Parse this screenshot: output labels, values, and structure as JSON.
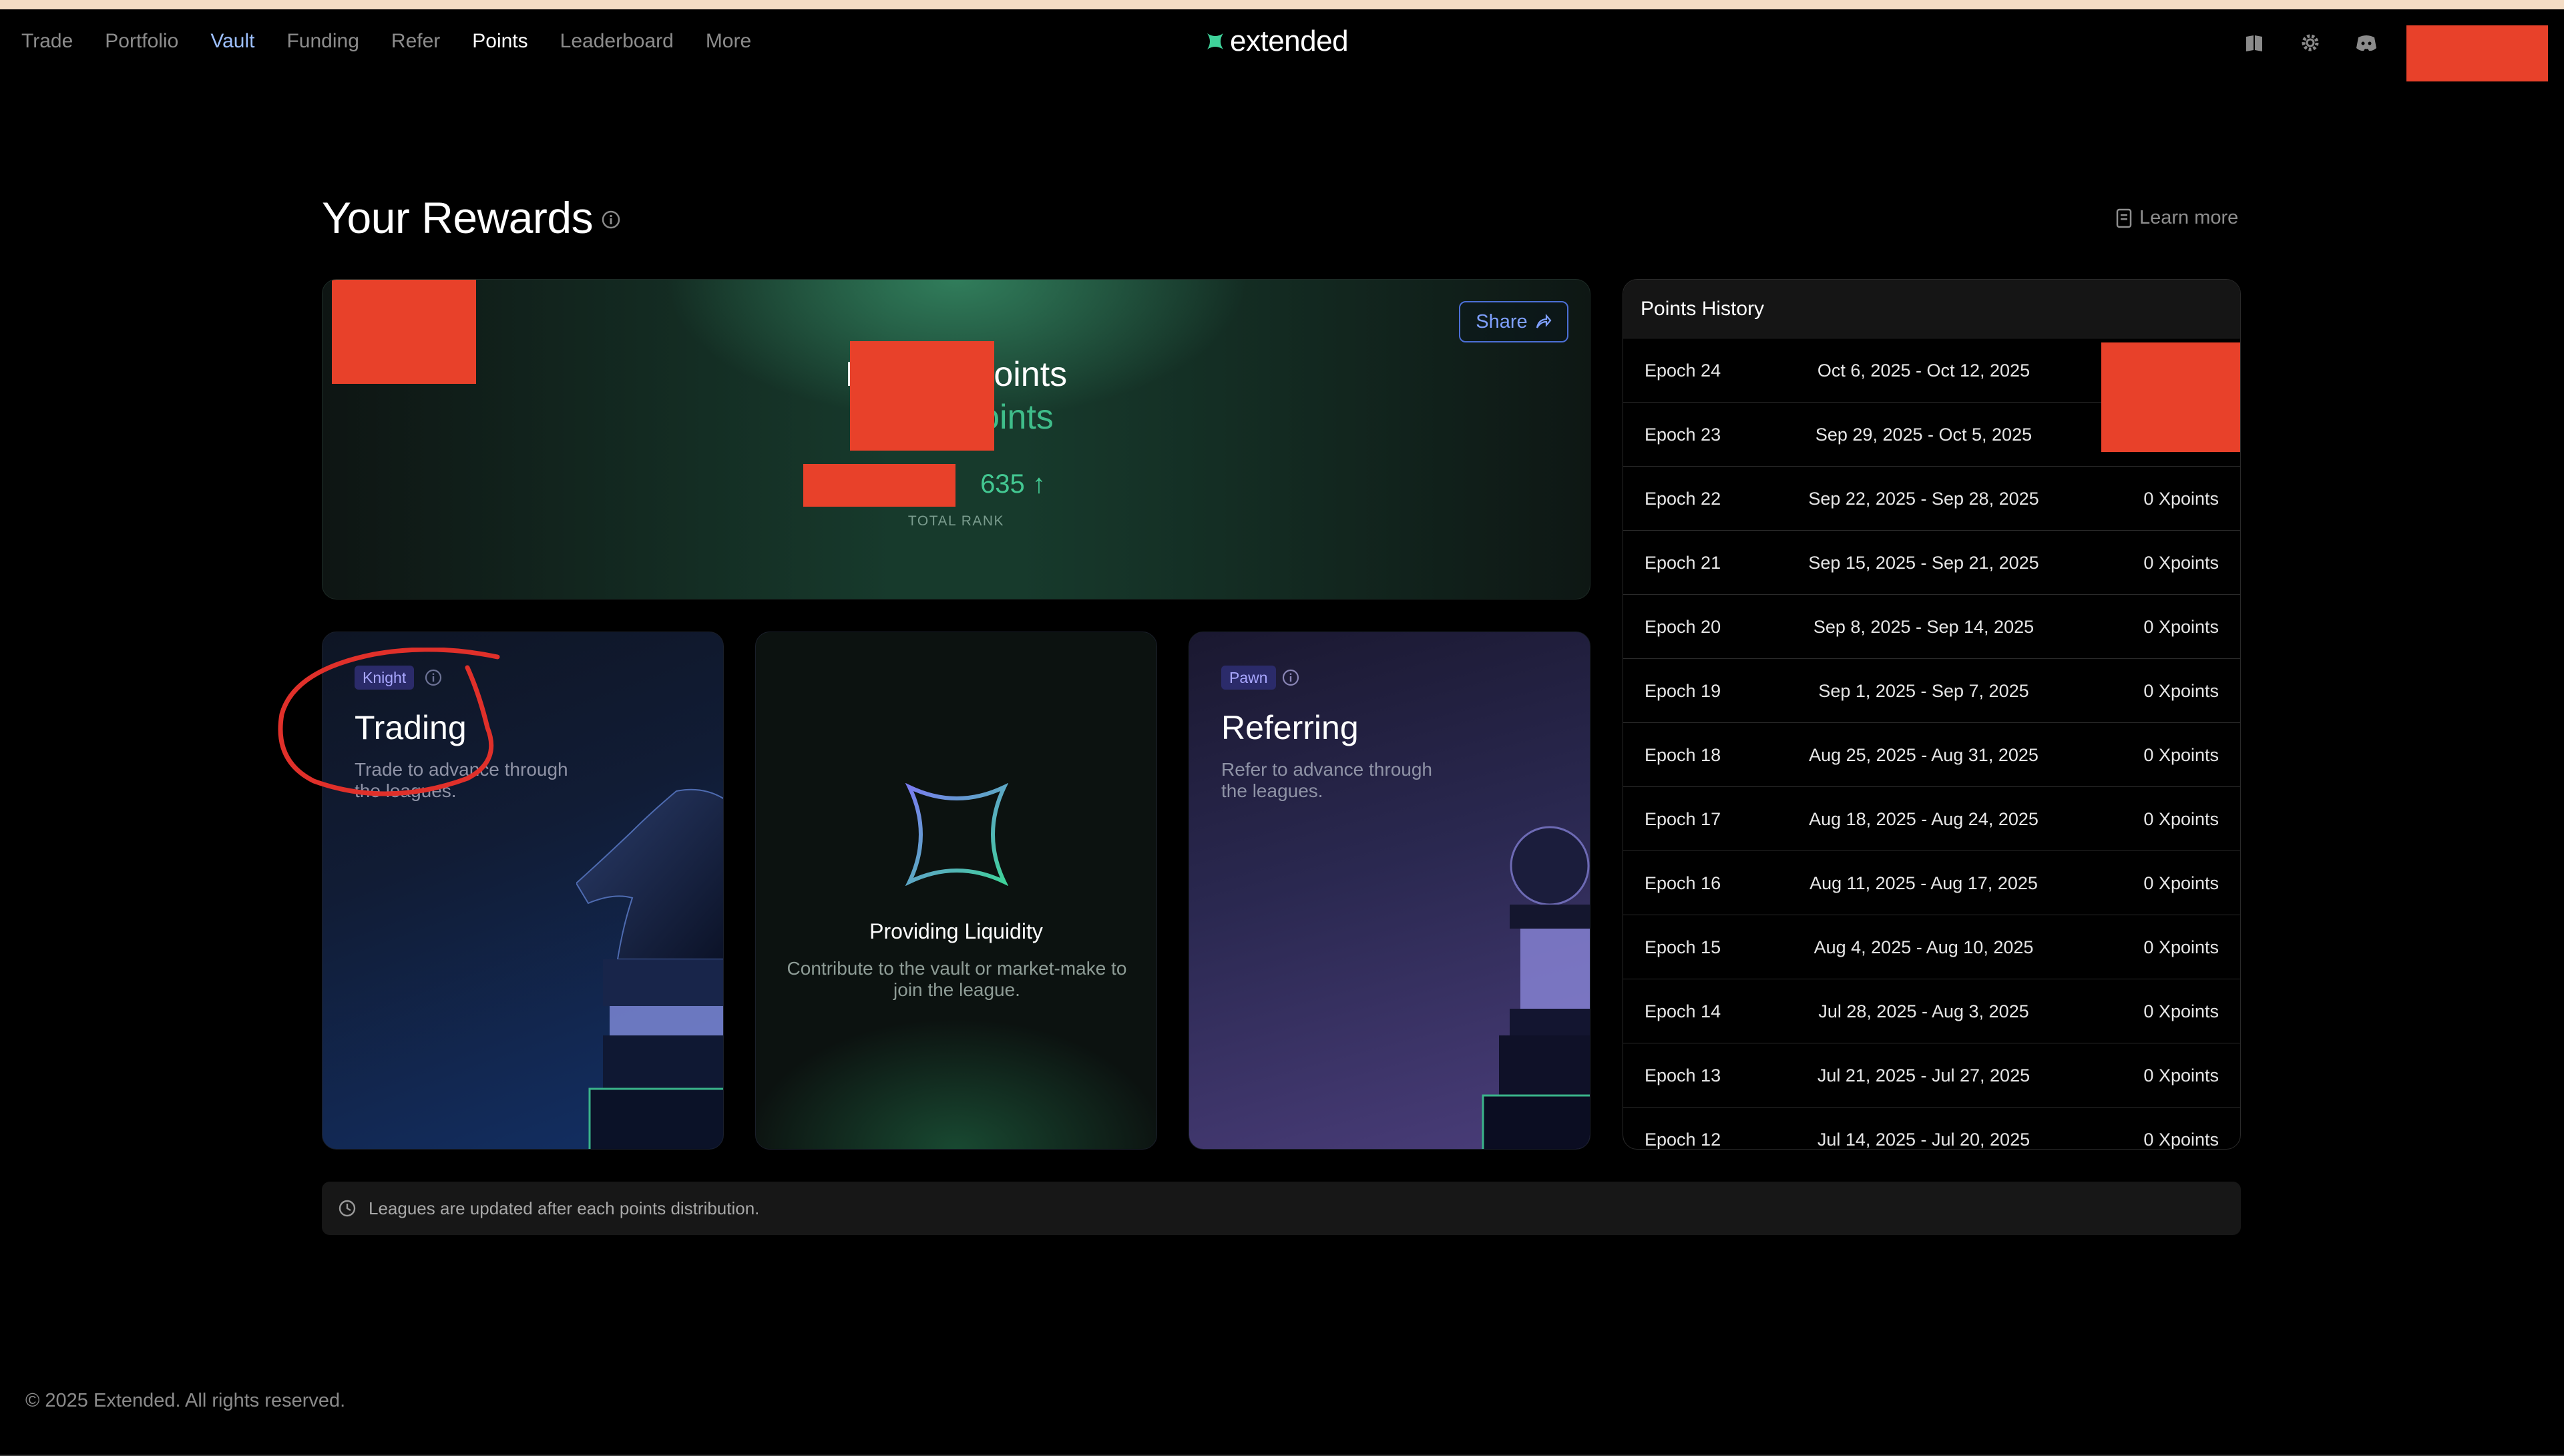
{
  "nav": {
    "links": [
      "Trade",
      "Portfolio",
      "Vault",
      "Funding",
      "Refer",
      "Points",
      "Leaderboard",
      "More"
    ],
    "logo": "extended"
  },
  "page": {
    "title": "Your Rewards",
    "learn_more": "Learn more"
  },
  "hero": {
    "share": "Share",
    "line1": "M          Points",
    "line2": "C          oints",
    "rank": "635",
    "rank_label": "TOTAL RANK"
  },
  "leagues": {
    "trading": {
      "badge": "Knight",
      "title": "Trading",
      "desc": "Trade to advance through the leagues."
    },
    "liquidity": {
      "title": "Providing Liquidity",
      "desc": "Contribute to the vault or market-make to join the league."
    },
    "referring": {
      "badge": "Pawn",
      "title": "Referring",
      "desc": "Refer to advance through the leagues."
    }
  },
  "history": {
    "title": "Points History",
    "rows": [
      {
        "epoch": "Epoch 24",
        "range": "Oct 6, 2025 - Oct 12, 2025",
        "points": ""
      },
      {
        "epoch": "Epoch 23",
        "range": "Sep 29, 2025 - Oct 5, 2025",
        "points": ""
      },
      {
        "epoch": "Epoch 22",
        "range": "Sep 22, 2025 - Sep 28, 2025",
        "points": "0 Xpoints"
      },
      {
        "epoch": "Epoch 21",
        "range": "Sep 15, 2025 - Sep 21, 2025",
        "points": "0 Xpoints"
      },
      {
        "epoch": "Epoch 20",
        "range": "Sep 8, 2025 - Sep 14, 2025",
        "points": "0 Xpoints"
      },
      {
        "epoch": "Epoch 19",
        "range": "Sep 1, 2025 - Sep 7, 2025",
        "points": "0 Xpoints"
      },
      {
        "epoch": "Epoch 18",
        "range": "Aug 25, 2025 - Aug 31, 2025",
        "points": "0 Xpoints"
      },
      {
        "epoch": "Epoch 17",
        "range": "Aug 18, 2025 - Aug 24, 2025",
        "points": "0 Xpoints"
      },
      {
        "epoch": "Epoch 16",
        "range": "Aug 11, 2025 - Aug 17, 2025",
        "points": "0 Xpoints"
      },
      {
        "epoch": "Epoch 15",
        "range": "Aug 4, 2025 - Aug 10, 2025",
        "points": "0 Xpoints"
      },
      {
        "epoch": "Epoch 14",
        "range": "Jul 28, 2025 - Aug 3, 2025",
        "points": "0 Xpoints"
      },
      {
        "epoch": "Epoch 13",
        "range": "Jul 21, 2025 - Jul 27, 2025",
        "points": "0 Xpoints"
      },
      {
        "epoch": "Epoch 12",
        "range": "Jul 14, 2025 - Jul 20, 2025",
        "points": "0 Xpoints"
      }
    ]
  },
  "notice": "Leagues are updated after each points distribution.",
  "footer": "© 2025 Extended. All rights reserved.",
  "colors": {
    "accent_green": "#3fbd8a",
    "nav_active_blue": "#9dc0ff",
    "share_blue": "#4c6fd6",
    "redaction": "#e8412a",
    "annotation_red": "#e0302a"
  },
  "icons": [
    "book-icon",
    "gear-icon",
    "discord-icon",
    "avatar-icon",
    "info-icon",
    "share-arrow-icon",
    "document-icon",
    "clock-icon"
  ]
}
